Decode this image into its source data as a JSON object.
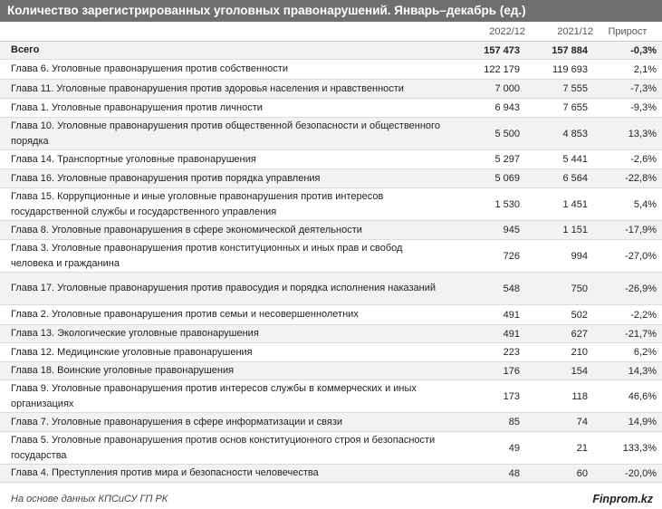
{
  "title": "Количество зарегистрированных уголовных правонарушений. Январь–декабрь (ед.)",
  "columns": {
    "name": "",
    "v1": "2022/12",
    "v2": "2021/12",
    "growth": "Прирост"
  },
  "rows": [
    {
      "name": "Всего",
      "v1": "157 473",
      "v2": "157 884",
      "g": "-0,3%"
    },
    {
      "name": "Глава 6. Уголовные правонарушения против собственности",
      "v1": "122 179",
      "v2": "119 693",
      "g": "2,1%"
    },
    {
      "name": "Глава 11. Уголовные правонарушения против здоровья населения и нравственности",
      "v1": "7 000",
      "v2": "7 555",
      "g": "-7,3%"
    },
    {
      "name": "Глава 1. Уголовные правонарушения против личности",
      "v1": "6 943",
      "v2": "7 655",
      "g": "-9,3%"
    },
    {
      "name": "Глава 10. Уголовные правонарушения против общественной безопасности и общественного порядка",
      "v1": "5 500",
      "v2": "4 853",
      "g": "13,3%"
    },
    {
      "name": "Глава 14. Транспортные уголовные правонарушения",
      "v1": "5 297",
      "v2": "5 441",
      "g": "-2,6%"
    },
    {
      "name": "Глава 16. Уголовные правонарушения против порядка управления",
      "v1": "5 069",
      "v2": "6 564",
      "g": "-22,8%"
    },
    {
      "name": "Глава 15. Коррупционные и иные уголовные правонарушения против интересов государственной службы и государственного управления",
      "v1": "1 530",
      "v2": "1 451",
      "g": "5,4%"
    },
    {
      "name": "Глава 8. Уголовные правонарушения в сфере экономической деятельности",
      "v1": "945",
      "v2": "1 151",
      "g": "-17,9%"
    },
    {
      "name": "Глава 3. Уголовные правонарушения против конституционных и иных прав и свобод человека и гражданина",
      "v1": "726",
      "v2": "994",
      "g": "-27,0%"
    },
    {
      "name": "Глава 17. Уголовные правонарушения против правосудия и порядка исполнения наказаний",
      "v1": "548",
      "v2": "750",
      "g": "-26,9%"
    },
    {
      "name": "Глава 2. Уголовные правонарушения против семьи и несовершеннолетних",
      "v1": "491",
      "v2": "502",
      "g": "-2,2%"
    },
    {
      "name": "Глава 13. Экологические уголовные правонарушения",
      "v1": "491",
      "v2": "627",
      "g": "-21,7%"
    },
    {
      "name": "Глава 12. Медицинские уголовные правонарушения",
      "v1": "223",
      "v2": "210",
      "g": "6,2%"
    },
    {
      "name": "Глава 18. Воинские уголовные правонарушения",
      "v1": "176",
      "v2": "154",
      "g": "14,3%"
    },
    {
      "name": "Глава 9. Уголовные правонарушения против интересов службы в коммерческих и иных организациях",
      "v1": "173",
      "v2": "118",
      "g": "46,6%"
    },
    {
      "name": "Глава 7. Уголовные правонарушения в сфере информатизации и связи",
      "v1": "85",
      "v2": "74",
      "g": "14,9%"
    },
    {
      "name": "Глава 5. Уголовные правонарушения против основ конституционного строя и безопасности государства",
      "v1": "49",
      "v2": "21",
      "g": "133,3%"
    },
    {
      "name": "Глава 4. Преступления против мира и безопасности человечества",
      "v1": "48",
      "v2": "60",
      "g": "-20,0%"
    }
  ],
  "footer": {
    "source": "На основе данных КПСиСУ ГП РК",
    "brand": "Finprom.kz"
  }
}
